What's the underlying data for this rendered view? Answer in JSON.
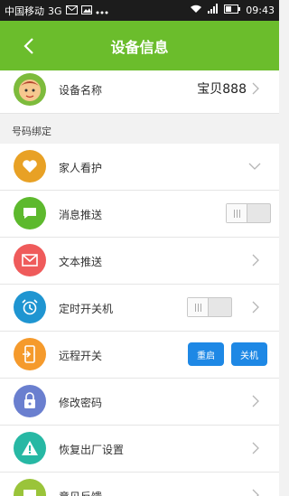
{
  "status_bar": {
    "carrier": "中国移动",
    "network": "3G",
    "time": "09:43"
  },
  "header": {
    "title": "设备信息"
  },
  "device": {
    "name_label": "设备名称",
    "name_value": "宝贝888"
  },
  "section": {
    "number_binding": "号码绑定"
  },
  "items": {
    "family_care": "家人看护",
    "message_push": "消息推送",
    "text_push": "文本推送",
    "timed_power": "定时开关机",
    "remote_switch": "远程开关",
    "change_password": "修改密码",
    "factory_reset": "恢复出厂设置",
    "feedback": "意见反馈"
  },
  "buttons": {
    "restart": "重启",
    "shutdown": "关机"
  },
  "toggles": {
    "message_push_on": false,
    "timed_power_on": false
  },
  "colors": {
    "header_green": "#6bbd2c",
    "family_care_icon": "#e8a125",
    "message_push_icon": "#5db92d",
    "text_push_icon": "#ef5b5b",
    "timed_power_icon": "#1f95d1",
    "remote_switch_icon": "#f59a2c",
    "change_password_icon": "#6a7fcf",
    "factory_reset_icon": "#27b8a4",
    "feedback_icon": "#9ac43a",
    "button_blue": "#1e88e5"
  }
}
